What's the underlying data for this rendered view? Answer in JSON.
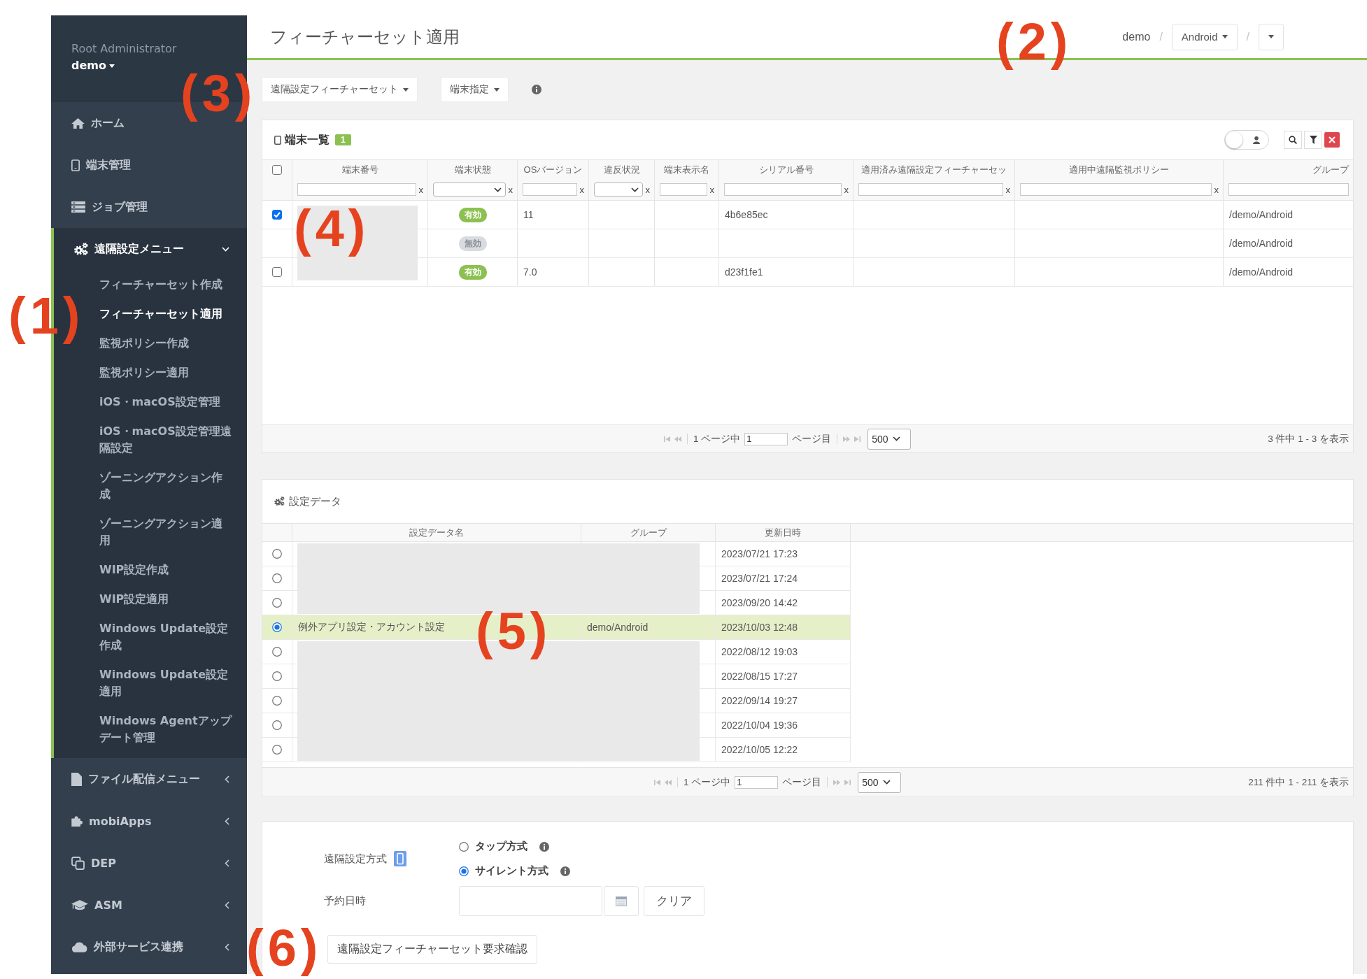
{
  "sidebar": {
    "user": {
      "role": "Root Administrator",
      "name": "demo"
    },
    "menu": [
      {
        "label": "ホーム",
        "selected": false
      },
      {
        "label": "端末管理",
        "selected": false
      },
      {
        "label": "ジョブ管理",
        "selected": false
      },
      {
        "label": "遠隔設定メニュー",
        "selected": true,
        "expanded": true,
        "children": [
          {
            "label": "フィーチャーセット作成",
            "selected": false
          },
          {
            "label": "フィーチャーセット適用",
            "selected": true
          },
          {
            "label": "監視ポリシー作成",
            "selected": false
          },
          {
            "label": "監視ポリシー適用",
            "selected": false
          },
          {
            "label": "iOS・macOS設定管理",
            "selected": false
          },
          {
            "label": "iOS・macOS設定管理遠隔設定",
            "selected": false
          },
          {
            "label": "ゾーニングアクション作成",
            "selected": false
          },
          {
            "label": "ゾーニングアクション適用",
            "selected": false
          },
          {
            "label": "WIP設定作成",
            "selected": false
          },
          {
            "label": "WIP設定適用",
            "selected": false
          },
          {
            "label": "Windows Update設定作成",
            "selected": false
          },
          {
            "label": "Windows Update設定適用",
            "selected": false
          },
          {
            "label": "Windows Agentアップデート管理",
            "selected": false
          }
        ]
      },
      {
        "label": "ファイル配信メニュー",
        "selected": false,
        "expanded": false
      },
      {
        "label": "mobiApps",
        "selected": false,
        "expanded": false
      },
      {
        "label": "DEP",
        "selected": false,
        "expanded": false
      },
      {
        "label": "ASM",
        "selected": false,
        "expanded": false
      },
      {
        "label": "外部サービス連携",
        "selected": false,
        "expanded": false
      }
    ]
  },
  "header": {
    "title": "フィーチャーセット適用",
    "breadcrumb": [
      {
        "kind": "text",
        "label": "demo"
      },
      {
        "kind": "separator",
        "label": "/"
      },
      {
        "kind": "dropdown",
        "label": "Android"
      },
      {
        "kind": "separator",
        "label": "/"
      },
      {
        "kind": "dropdown"
      }
    ]
  },
  "toolbar": [
    {
      "kind": "dropdown",
      "label": "遠隔設定フィーチャーセット"
    },
    {
      "kind": "dropdown",
      "label": "端末指定"
    },
    {
      "kind": "info"
    }
  ],
  "device_list": {
    "title": "端末一覧",
    "count": "1",
    "toggle": {
      "on": false
    },
    "select_all": {
      "checked": false
    },
    "columns": [
      {
        "title": "端末番号",
        "kind": "text",
        "clear": "x"
      },
      {
        "title": "端末状態",
        "kind": "select",
        "clear": "x"
      },
      {
        "title": "OSバージョン",
        "kind": "text",
        "clear": "x"
      },
      {
        "title": "違反状況",
        "kind": "select",
        "clear": "x"
      },
      {
        "title": "端末表示名",
        "kind": "text",
        "clear": "x"
      },
      {
        "title": "シリアル番号",
        "kind": "text",
        "clear": "x"
      },
      {
        "title": "適用済み遠隔設定フィーチャーセッ",
        "kind": "text",
        "clear": "x"
      },
      {
        "title": "適用中遠隔監視ポリシー",
        "kind": "text",
        "clear": "x"
      },
      {
        "title": "グループ",
        "kind": "text"
      }
    ],
    "rows": [
      {
        "checked": true,
        "redacted": true,
        "status": {
          "label": "有効",
          "enabled": true
        },
        "os_version": "11",
        "serial": "4b6e85ec",
        "group": "/demo/Android"
      },
      {
        "redacted": true,
        "status": {
          "label": "無効",
          "enabled": false
        },
        "group": "/demo/Android"
      },
      {
        "checked": false,
        "redacted": true,
        "status": {
          "label": "有効",
          "enabled": true
        },
        "os_version": "7.0",
        "serial": "d23f1fe1",
        "group": "/demo/Android"
      }
    ],
    "pager": {
      "page_prefix": "1 ページ中",
      "page": "1",
      "page_suffix": "ページ目",
      "page_size": "500",
      "summary": "3 件中 1 - 3 を表示"
    }
  },
  "settings_data": {
    "title": "設定データ",
    "columns": [
      {
        "title": "設定データ名"
      },
      {
        "title": "グループ"
      },
      {
        "title": "更新日時"
      }
    ],
    "rows": [
      {
        "selected": false,
        "redacted": true,
        "updated": "2023/07/21 17:23"
      },
      {
        "selected": false,
        "redacted": true,
        "updated": "2023/07/21 17:24"
      },
      {
        "selected": false,
        "redacted": true,
        "updated": "2023/09/20 14:42"
      },
      {
        "selected": true,
        "redacted": false,
        "name": "例外アプリ設定・アカウント設定",
        "group": "demo/Android",
        "updated": "2023/10/03 12:48"
      },
      {
        "selected": false,
        "redacted": true,
        "updated": "2022/08/12 19:03"
      },
      {
        "selected": false,
        "redacted": true,
        "updated": "2022/08/15 17:27"
      },
      {
        "selected": false,
        "redacted": true,
        "updated": "2022/09/14 19:27"
      },
      {
        "selected": false,
        "redacted": true,
        "updated": "2022/10/04 19:36"
      },
      {
        "selected": false,
        "redacted": true,
        "updated": "2022/10/05 12:22"
      }
    ],
    "pager": {
      "page_prefix": "1 ページ中",
      "page": "1",
      "page_suffix": "ページ目",
      "page_size": "500",
      "summary": "211 件中 1 - 211 を表示"
    }
  },
  "apply_form": {
    "method": {
      "label": "遠隔設定方式",
      "options": [
        {
          "label": "タップ方式",
          "selected": false
        },
        {
          "label": "サイレント方式",
          "selected": true
        }
      ]
    },
    "schedule": {
      "label": "予約日時",
      "clear_button": "クリア"
    },
    "submit": "遠隔設定フィーチャーセット要求確認"
  },
  "annotations": [
    "(1)",
    "(2)",
    "(3)",
    "(4)",
    "(5)",
    "(6)"
  ]
}
